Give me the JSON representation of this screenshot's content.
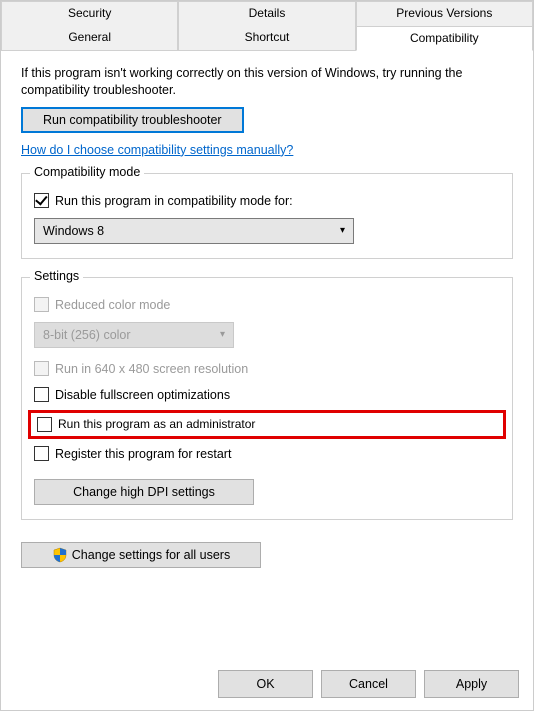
{
  "tabs": {
    "row1": [
      "Security",
      "Details",
      "Previous Versions"
    ],
    "row2": [
      "General",
      "Shortcut",
      "Compatibility"
    ],
    "active": "Compatibility"
  },
  "intro": "If this program isn't working correctly on this version of Windows, try running the compatibility troubleshooter.",
  "troubleshoot_btn": "Run compatibility troubleshooter",
  "help_link": "How do I choose compatibility settings manually?",
  "compat_mode": {
    "title": "Compatibility mode",
    "checkbox_label": "Run this program in compatibility mode for:",
    "checked": true,
    "selected_os": "Windows 8"
  },
  "settings": {
    "title": "Settings",
    "reduced_color": {
      "label": "Reduced color mode",
      "checked": false,
      "enabled": false
    },
    "color_depth": "8-bit (256) color",
    "run_640": {
      "label": "Run in 640 x 480 screen resolution",
      "checked": false,
      "enabled": false
    },
    "disable_fullscreen": {
      "label": "Disable fullscreen optimizations",
      "checked": false,
      "enabled": true
    },
    "run_admin": {
      "label": "Run this program as an administrator",
      "checked": false,
      "enabled": true
    },
    "register_restart": {
      "label": "Register this program for restart",
      "checked": false,
      "enabled": true
    },
    "dpi_btn": "Change high DPI settings"
  },
  "all_users_btn": "Change settings for all users",
  "footer": {
    "ok": "OK",
    "cancel": "Cancel",
    "apply": "Apply"
  }
}
